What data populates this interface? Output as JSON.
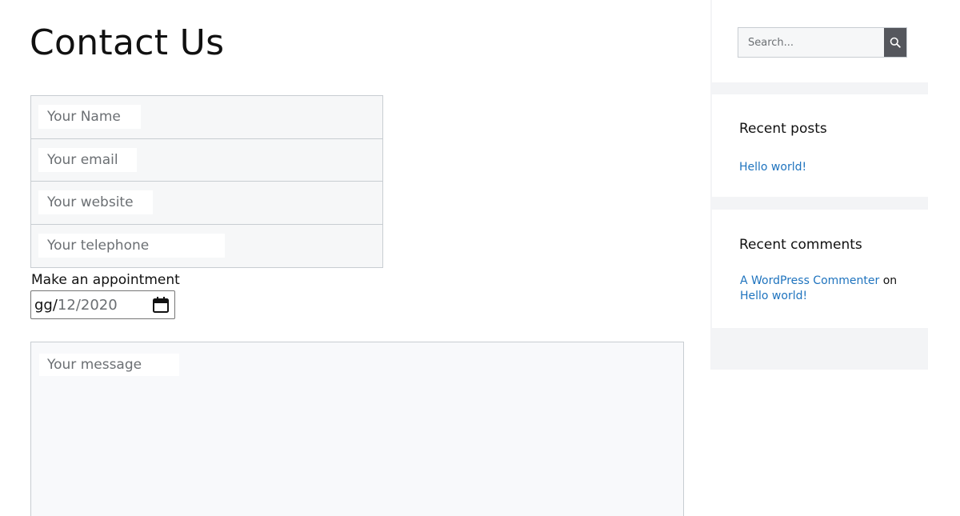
{
  "page": {
    "title": "Contact Us"
  },
  "form": {
    "name_placeholder": "Your Name",
    "email_placeholder": "Your email",
    "website_placeholder": "Your website",
    "telephone_placeholder": "Your telephone",
    "appointment_label": "Make an appointment",
    "date_day": "gg/",
    "date_rest": "12/2020",
    "message_placeholder": "Your message"
  },
  "sidebar": {
    "search": {
      "placeholder": "Search...",
      "button_icon": "search-icon"
    },
    "recent_posts": {
      "title": "Recent posts",
      "items": [
        "Hello world!"
      ]
    },
    "recent_comments": {
      "title": "Recent comments",
      "items": [
        {
          "author": "A WordPress Commenter",
          "connector": "on",
          "post": "Hello world!"
        }
      ]
    }
  },
  "colors": {
    "link": "#1e73be",
    "search_button": "#55575d",
    "field_background": "#f6f7f8",
    "border": "#c8cdd2"
  }
}
